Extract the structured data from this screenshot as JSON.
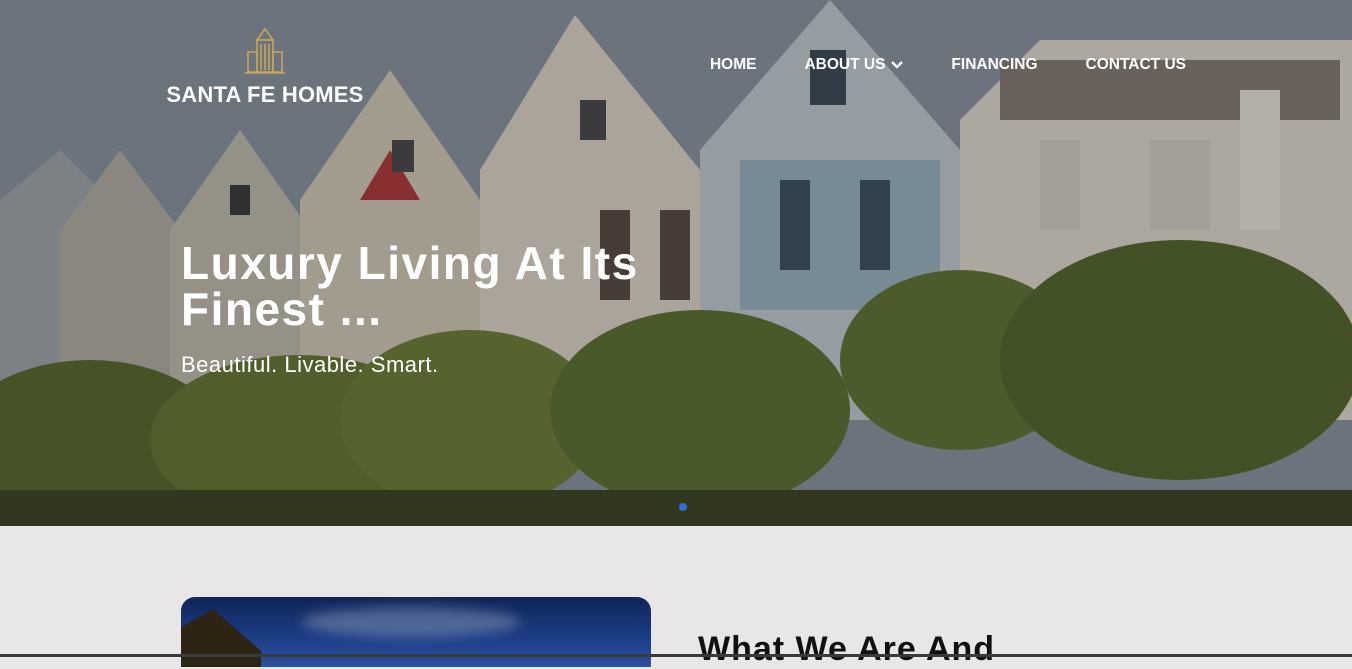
{
  "brand": {
    "name": "SANTA FE HOMES",
    "logo_icon": "building-logo-icon",
    "logo_color": "#c9a45a"
  },
  "nav": {
    "items": [
      {
        "label": "HOME",
        "has_dropdown": false
      },
      {
        "label": "ABOUT US",
        "has_dropdown": true
      },
      {
        "label": "FINANCING",
        "has_dropdown": false
      },
      {
        "label": "CONTACT US",
        "has_dropdown": false
      }
    ]
  },
  "hero": {
    "headline": "Luxury Living At Its Finest ...",
    "tagline": "Beautiful. Livable. Smart.",
    "slider_dot_color": "#2f6fe0",
    "background": "painted-lady-victorian-houses-photo"
  },
  "section": {
    "title": "What We Are And"
  },
  "colors": {
    "text_light": "#ffffff",
    "section_bg": "#e8e6e7",
    "title_dark": "#111111"
  }
}
